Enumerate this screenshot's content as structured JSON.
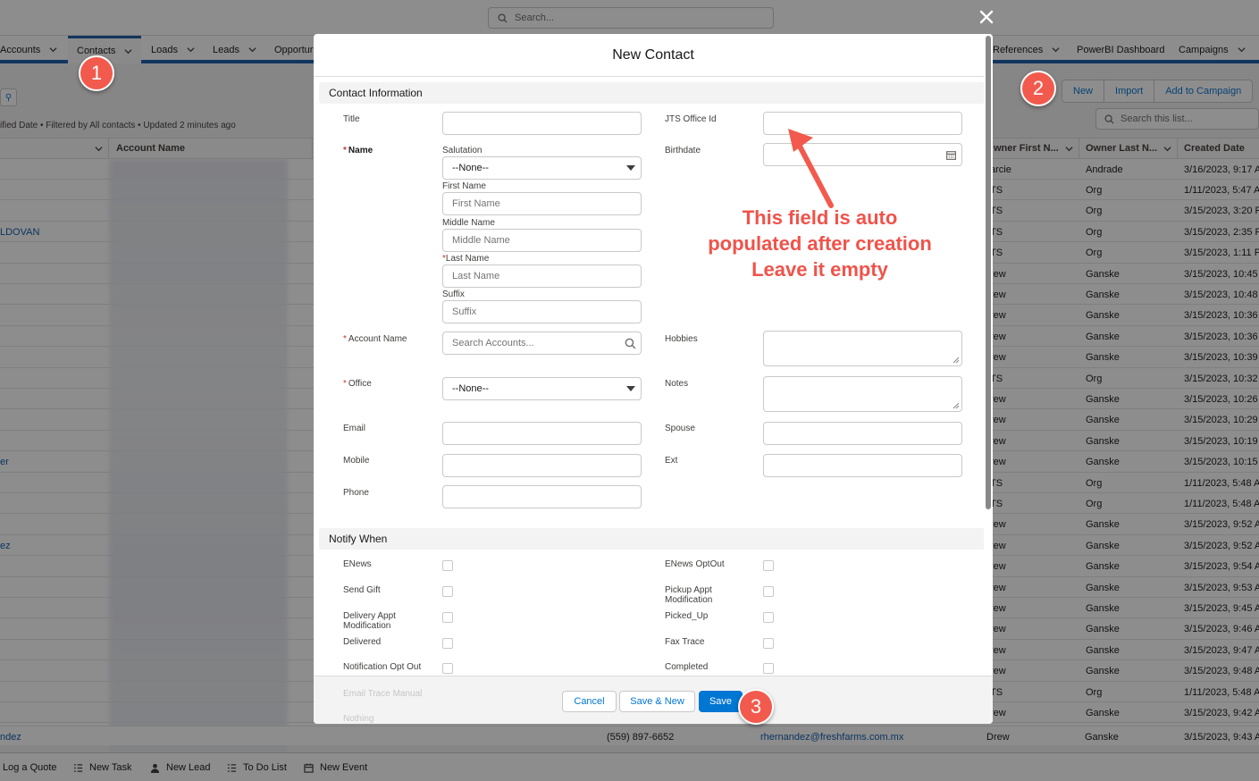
{
  "global_search": {
    "placeholder": "Search..."
  },
  "nav": {
    "items": [
      {
        "label": "Accounts"
      },
      {
        "label": "Contacts"
      },
      {
        "label": "Loads"
      },
      {
        "label": "Leads"
      },
      {
        "label": "Opportur"
      },
      {
        "label": "References"
      },
      {
        "label": "PowerBI Dashboard"
      },
      {
        "label": "Campaigns"
      }
    ]
  },
  "list": {
    "actions": {
      "new": "New",
      "import": "Import",
      "add_to_campaign": "Add to Campaign"
    },
    "search_placeholder": "Search this list...",
    "meta": "ified Date • Filtered by All contacts • Updated 2 minutes ago",
    "columns": {
      "account_name": "Account Name",
      "owner_first": "wner First N...",
      "owner_last": "Owner Last N...",
      "created": "Created Date"
    },
    "left_links": [
      "LDOVAN",
      "er",
      "ez"
    ],
    "rows": [
      {
        "first": "arcie",
        "last": "Andrade",
        "date": "3/16/2023, 9:17 A"
      },
      {
        "first": "TS",
        "last": "Org",
        "date": "1/11/2023, 5:47 A"
      },
      {
        "first": "TS",
        "last": "Org",
        "date": "3/15/2023, 3:20 P"
      },
      {
        "first": "TS",
        "last": "Org",
        "date": "3/15/2023, 2:35 P"
      },
      {
        "first": "TS",
        "last": "Org",
        "date": "3/15/2023, 1:11 PI"
      },
      {
        "first": "rew",
        "last": "Ganske",
        "date": "3/15/2023, 10:45"
      },
      {
        "first": "rew",
        "last": "Ganske",
        "date": "3/15/2023, 10:48"
      },
      {
        "first": "rew",
        "last": "Ganske",
        "date": "3/15/2023, 10:36"
      },
      {
        "first": "rew",
        "last": "Ganske",
        "date": "3/15/2023, 10:36"
      },
      {
        "first": "rew",
        "last": "Ganske",
        "date": "3/15/2023, 10:39"
      },
      {
        "first": "TS",
        "last": "Org",
        "date": "3/15/2023, 10:32"
      },
      {
        "first": "rew",
        "last": "Ganske",
        "date": "3/15/2023, 10:26"
      },
      {
        "first": "rew",
        "last": "Ganske",
        "date": "3/15/2023, 10:29"
      },
      {
        "first": "rew",
        "last": "Ganske",
        "date": "3/15/2023, 10:19"
      },
      {
        "first": "rew",
        "last": "Ganske",
        "date": "3/15/2023, 10:15"
      },
      {
        "first": "TS",
        "last": "Org",
        "date": "1/11/2023, 5:48 A"
      },
      {
        "first": "TS",
        "last": "Org",
        "date": "1/11/2023, 5:48 A"
      },
      {
        "first": "rew",
        "last": "Ganske",
        "date": "3/15/2023, 9:52 A"
      },
      {
        "first": "rew",
        "last": "Ganske",
        "date": "3/15/2023, 9:52 A"
      },
      {
        "first": "rew",
        "last": "Ganske",
        "date": "3/15/2023, 9:54 A"
      },
      {
        "first": "rew",
        "last": "Ganske",
        "date": "3/15/2023, 9:53 A"
      },
      {
        "first": "rew",
        "last": "Ganske",
        "date": "3/15/2023, 9:45 A"
      },
      {
        "first": "rew",
        "last": "Ganske",
        "date": "3/15/2023, 9:46 A"
      },
      {
        "first": "rew",
        "last": "Ganske",
        "date": "3/15/2023, 9:47 A"
      },
      {
        "first": "rew",
        "last": "Ganske",
        "date": "3/15/2023, 9:48 A"
      },
      {
        "first": "TS",
        "last": "Org",
        "date": "1/11/2023, 5:48 A"
      },
      {
        "first": "rew",
        "last": "Ganske",
        "date": "3/15/2023, 9:42 A"
      }
    ],
    "bottom_row": {
      "left": "ndez",
      "phone": "(559) 897-6652",
      "email": "rhernandez@freshfarms.com.mx",
      "first": "Drew",
      "last": "Ganske",
      "date": "3/15/2023, 9:43 A"
    }
  },
  "utility_bar": {
    "items": [
      {
        "label": "Log a Quote",
        "icon": "quote-icon"
      },
      {
        "label": "New Task",
        "icon": "task-list-icon"
      },
      {
        "label": "New Lead",
        "icon": "person-icon"
      },
      {
        "label": "To Do List",
        "icon": "todo-list-icon"
      },
      {
        "label": "New Event",
        "icon": "calendar-icon"
      }
    ]
  },
  "modal": {
    "title": "New Contact",
    "section_contact": "Contact Information",
    "section_notify": "Notify When",
    "fields": {
      "title": "Title",
      "jts_office_id": "JTS Office Id",
      "name": "Name",
      "birthdate": "Birthdate",
      "salutation": "Salutation",
      "salutation_value": "--None--",
      "first_name": "First Name",
      "first_name_ph": "First Name",
      "middle_name": "Middle Name",
      "middle_name_ph": "Middle Name",
      "last_name": "Last Name",
      "last_name_ph": "Last Name",
      "suffix": "Suffix",
      "suffix_ph": "Suffix",
      "account_name": "Account Name",
      "account_ph": "Search Accounts...",
      "hobbies": "Hobbies",
      "office": "Office",
      "office_value": "--None--",
      "notes": "Notes",
      "email": "Email",
      "spouse": "Spouse",
      "mobile": "Mobile",
      "ext": "Ext",
      "phone": "Phone"
    },
    "notify": {
      "left": [
        "ENews",
        "Send Gift",
        "Delivery Appt Modification",
        "Delivered",
        "Notification Opt Out",
        "Email Trace Manual",
        "Nothing"
      ],
      "right": [
        "ENews OptOut",
        "Pickup Appt Modification",
        "Picked_Up",
        "Fax Trace",
        "Completed"
      ]
    },
    "buttons": {
      "cancel": "Cancel",
      "save_new": "Save & New",
      "save": "Save"
    }
  },
  "annotations": {
    "badges": [
      "1",
      "2",
      "3"
    ],
    "note": "This field is auto populated after creation Leave it empty",
    "note_lines": [
      "This field is auto",
      "populated after creation",
      "Leave it empty"
    ],
    "color": "#f25a4d"
  },
  "colors": {
    "brand": "#0176d3",
    "nav_accent": "#1b5eab",
    "required": "#c23934"
  }
}
